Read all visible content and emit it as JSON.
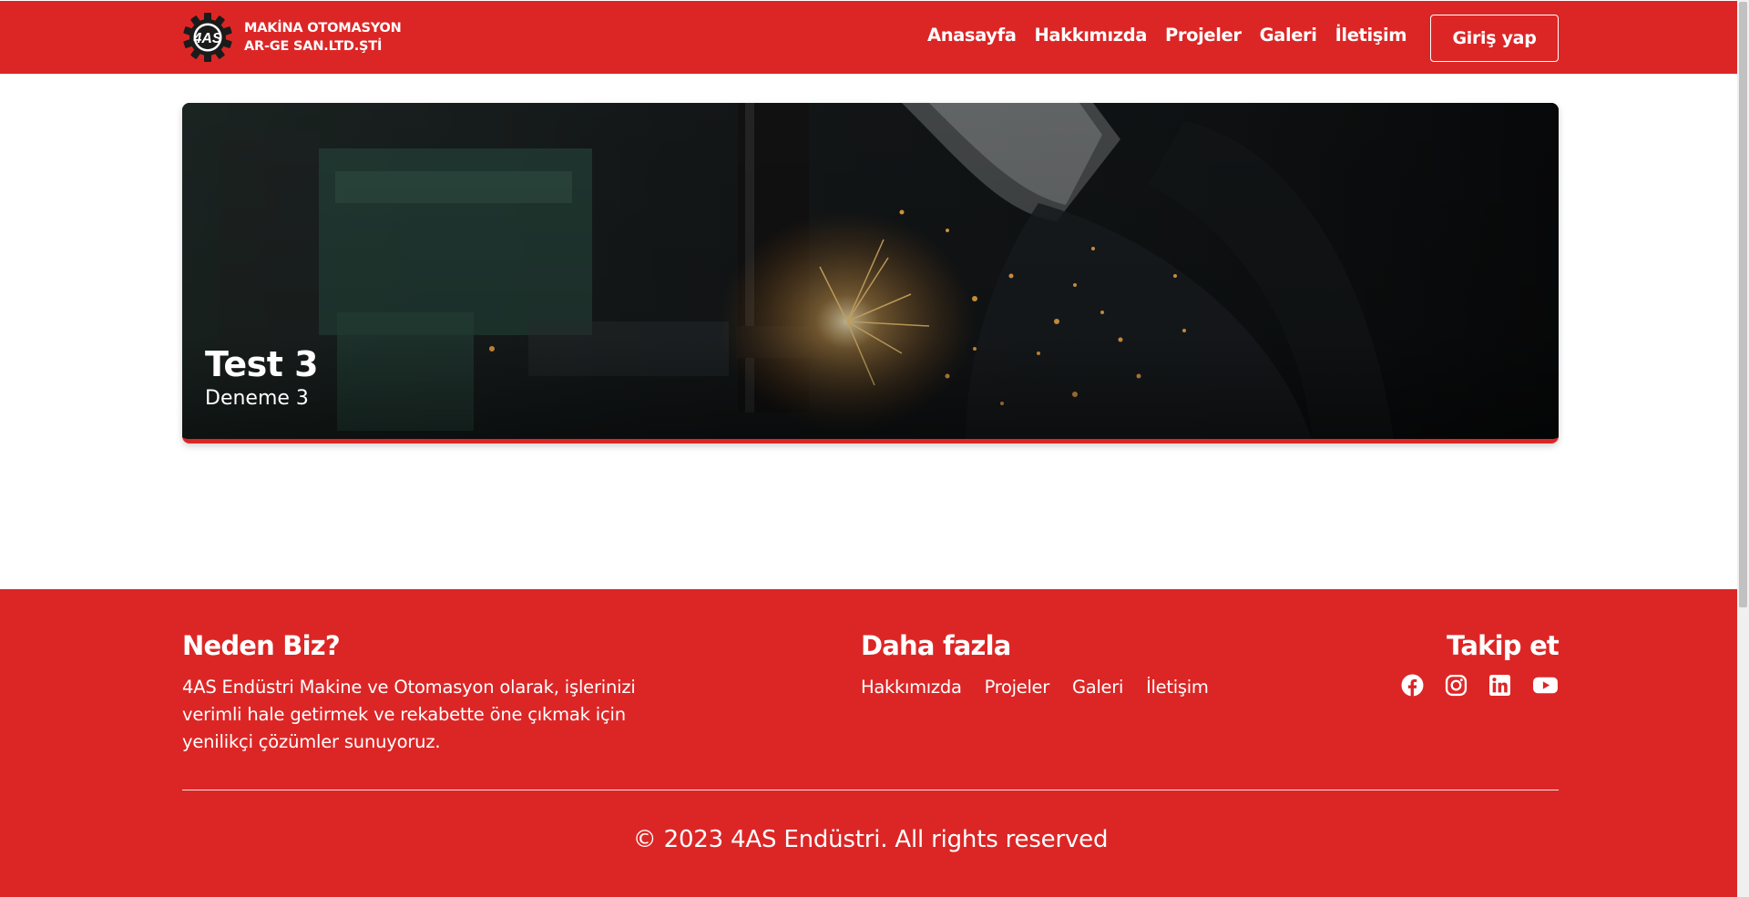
{
  "header": {
    "brand": {
      "line1": "MAKİNA OTOMASYON",
      "line2": "AR-GE SAN.LTD.ŞTİ",
      "logo_text": "4AS"
    },
    "nav": [
      {
        "label": "Anasayfa"
      },
      {
        "label": "Hakkımızda"
      },
      {
        "label": "Projeler"
      },
      {
        "label": "Galeri"
      },
      {
        "label": "İletişim"
      }
    ],
    "login_label": "Giriş yap"
  },
  "hero": {
    "title": "Test 3",
    "subtitle": "Deneme 3",
    "image_icon": "welding-photo"
  },
  "footer": {
    "why": {
      "title": "Neden Biz?",
      "text": "4AS Endüstri Makine ve Otomasyon olarak, işlerinizi verimli hale getirmek ve rekabette öne çıkmak için yenilikçi çözümler sunuyoruz."
    },
    "more": {
      "title": "Daha fazla",
      "links": [
        {
          "label": "Hakkımızda"
        },
        {
          "label": "Projeler"
        },
        {
          "label": "Galeri"
        },
        {
          "label": "İletişim"
        }
      ]
    },
    "follow": {
      "title": "Takip et",
      "icons": [
        "facebook-icon",
        "instagram-icon",
        "linkedin-icon",
        "youtube-icon"
      ]
    },
    "copyright": "© 2023 4AS Endüstri. All rights reserved"
  },
  "colors": {
    "primary": "#dc2626",
    "text_on_primary": "#ffffff",
    "background": "#ffffff"
  }
}
